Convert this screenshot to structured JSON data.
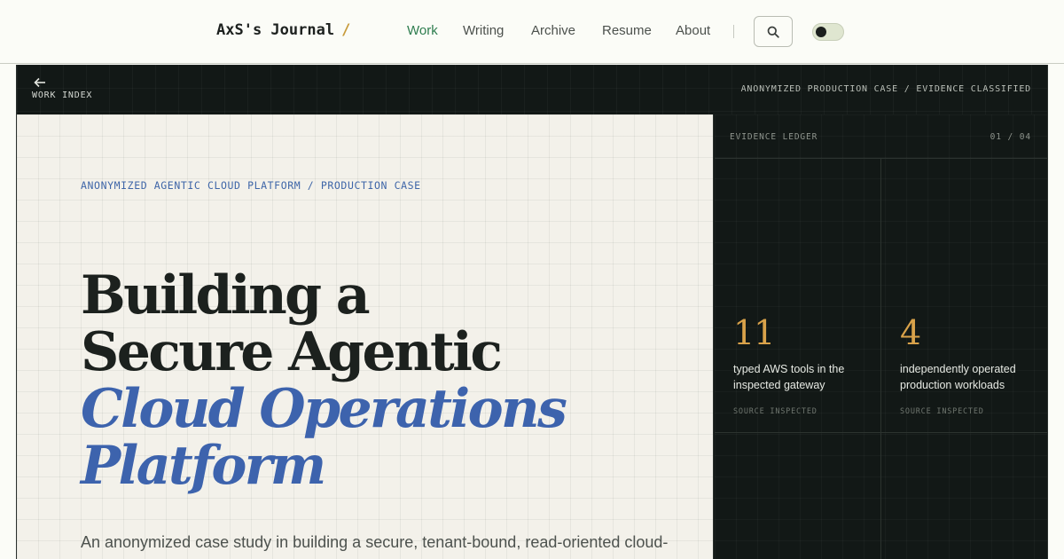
{
  "site": {
    "title": "AxS's Journal",
    "title_suffix": "/"
  },
  "nav": {
    "items": [
      {
        "label": "Work",
        "active": true
      },
      {
        "label": "Writing",
        "active": false
      },
      {
        "label": "Archive",
        "active": false
      },
      {
        "label": "Resume",
        "active": false
      },
      {
        "label": "About",
        "active": false
      }
    ],
    "search_icon": "search-icon",
    "theme_toggle_state": "dark"
  },
  "case_header": {
    "back_label": "WORK INDEX",
    "back_icon": "arrow-left-icon",
    "tag": "ANONYMIZED PRODUCTION CASE / EVIDENCE CLASSIFIED"
  },
  "hero": {
    "eyebrow": "ANONYMIZED AGENTIC CLOUD PLATFORM / PRODUCTION CASE",
    "title_line_1": "Building a",
    "title_line_2": "Secure Agentic",
    "title_line_3": "Cloud Operations",
    "title_line_4": "Platform",
    "lede": "An anonymized case study in building a secure, tenant-bound, read-oriented cloud-"
  },
  "ledger": {
    "title": "EVIDENCE LEDGER",
    "page": "01 / 04",
    "stats": [
      {
        "value": "11",
        "label": "typed AWS tools in the inspected gateway",
        "source": "SOURCE INSPECTED"
      },
      {
        "value": "4",
        "label": "independently operated production workloads",
        "source": "SOURCE INSPECTED"
      }
    ]
  },
  "colors": {
    "accent_green": "#2e7d4f",
    "accent_blue": "#3d63ad",
    "accent_gold": "#d9a24a",
    "brand_slash": "#c79a3a",
    "dark_panel": "#121816",
    "paper": "#f3f1ea"
  }
}
